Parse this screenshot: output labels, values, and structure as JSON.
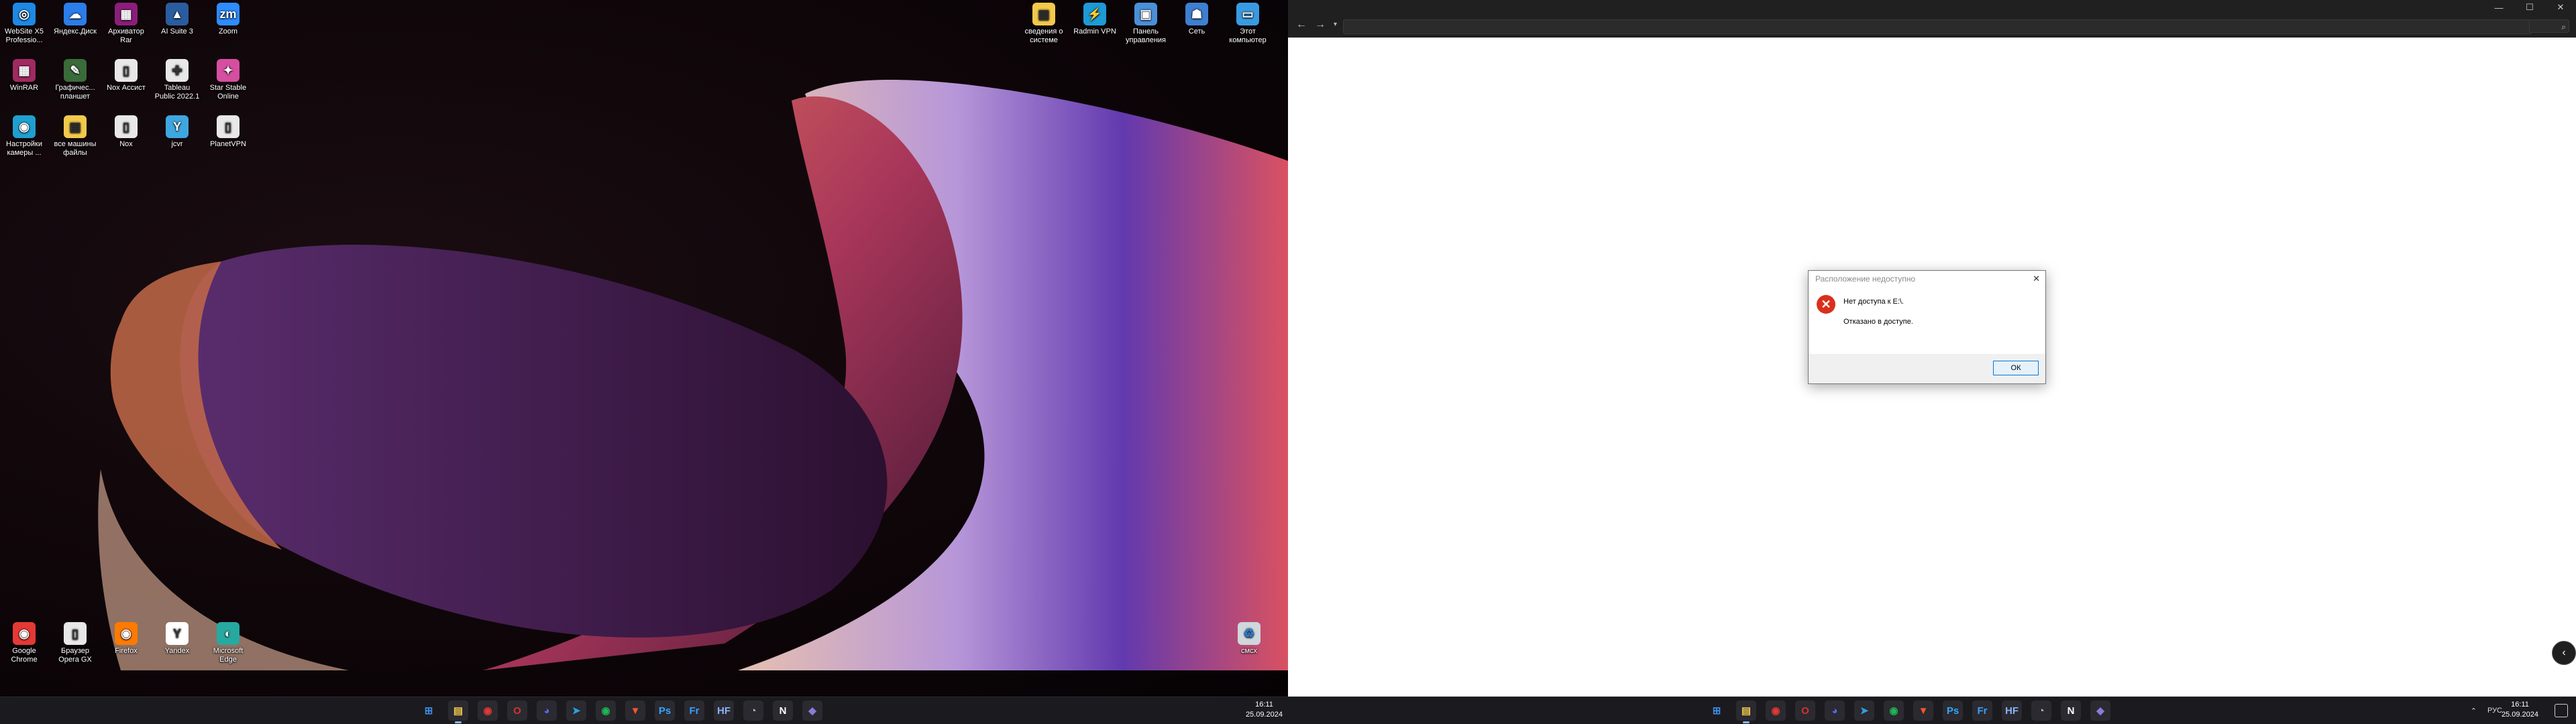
{
  "left_desktop": {
    "icons": [
      {
        "label": "WebSite X5 Professio...",
        "color": "#1e88e5",
        "glyph": "◎"
      },
      {
        "label": "Яндекс.Диск",
        "color": "#2b7de9",
        "glyph": "☁"
      },
      {
        "label": "Архиватор Rar",
        "color": "#8b1e7a",
        "glyph": "▦"
      },
      {
        "label": "AI Suite 3",
        "color": "#2a5d9f",
        "glyph": "▲"
      },
      {
        "label": "Zoom",
        "color": "#2d8cff",
        "glyph": "zm"
      },
      {
        "label": "WinRAR",
        "color": "#a02a62",
        "glyph": "▦"
      },
      {
        "label": "Графичес... планшет",
        "color": "#3a6b3a",
        "glyph": "✎"
      },
      {
        "label": "Nox Ассист",
        "color": "#e8e8e8",
        "glyph": "▯"
      },
      {
        "label": "Tableau Public 2022.1",
        "color": "#e8e8e8",
        "glyph": "✚"
      },
      {
        "label": "Star Stable Online",
        "color": "#d64ea0",
        "glyph": "✦"
      },
      {
        "label": "Настройки камеры ...",
        "color": "#1f9fd0",
        "glyph": "◉"
      },
      {
        "label": "все машины файлы",
        "color": "#f2c94c",
        "glyph": "▤"
      },
      {
        "label": "Nox",
        "color": "#e8e8e8",
        "glyph": "▯"
      },
      {
        "label": "jcvr",
        "color": "#3fa7e0",
        "glyph": "Y"
      },
      {
        "label": "PlanetVPN",
        "color": "#e8e8e8",
        "glyph": "▯"
      }
    ],
    "right_icons": [
      {
        "label": "сведения о системе",
        "color": "#f2c94c",
        "glyph": "▤"
      },
      {
        "label": "Radmin VPN",
        "color": "#1e9ad6",
        "glyph": "⚡"
      },
      {
        "label": "Панель управления",
        "color": "#4a90d9",
        "glyph": "▣"
      },
      {
        "label": "Сеть",
        "color": "#3f7fd1",
        "glyph": "☗"
      },
      {
        "label": "Этот компьютер",
        "color": "#3a9ae0",
        "glyph": "▭"
      }
    ],
    "bottom_icons": [
      {
        "label": "Google Chrome",
        "color": "#e53935",
        "glyph": "◉"
      },
      {
        "label": "Браузер Opera GX",
        "color": "#e8e8e8",
        "glyph": "▯"
      },
      {
        "label": "Firefox",
        "color": "#ff7a00",
        "glyph": "◉"
      },
      {
        "label": "Yandex",
        "color": "#ffffff",
        "glyph": "Y"
      },
      {
        "label": "Microsoft Edge",
        "color": "#27a9a1",
        "glyph": "◐"
      }
    ],
    "recycle_bin": {
      "label": "смсх",
      "color": "#cfd8dc",
      "glyph": "♻"
    },
    "taskbar": {
      "time": "16:11",
      "date": "25.09.2024",
      "apps": [
        {
          "name": "start",
          "glyph": "⊞",
          "color": "#3d8ee8"
        },
        {
          "name": "file-explorer",
          "glyph": "▤",
          "color": "#f2c94c"
        },
        {
          "name": "chrome",
          "glyph": "◉",
          "color": "#e53935"
        },
        {
          "name": "opera",
          "glyph": "O",
          "color": "#d0342c"
        },
        {
          "name": "discord",
          "glyph": "◕",
          "color": "#5865f2"
        },
        {
          "name": "telegram",
          "glyph": "➤",
          "color": "#2aa3e0"
        },
        {
          "name": "spotify",
          "glyph": "◉",
          "color": "#1db954"
        },
        {
          "name": "brave",
          "glyph": "▼",
          "color": "#fb542b"
        },
        {
          "name": "photoshop",
          "glyph": "Ps",
          "color": "#31a8ff"
        },
        {
          "name": "fresco",
          "glyph": "Fr",
          "color": "#3aa0ff"
        },
        {
          "name": "app-hw",
          "glyph": "HF",
          "color": "#8ab4f8"
        },
        {
          "name": "app-gauge",
          "glyph": "◔",
          "color": "#bbbbbb"
        },
        {
          "name": "notion",
          "glyph": "N",
          "color": "#ffffff"
        },
        {
          "name": "app-purple",
          "glyph": "◆",
          "color": "#8a7bd8"
        }
      ]
    }
  },
  "right_screen": {
    "explorer": {
      "search_placeholder": "⌕"
    },
    "dialog": {
      "title": "Расположение недоступно",
      "message1": "Нет доступа к E:\\.",
      "message2": "Отказано в доступе.",
      "ok_label": "ОК"
    },
    "taskbar": {
      "time": "16:11",
      "date": "25.09.2024",
      "lang": "РУС",
      "chevron": "⌃"
    }
  }
}
